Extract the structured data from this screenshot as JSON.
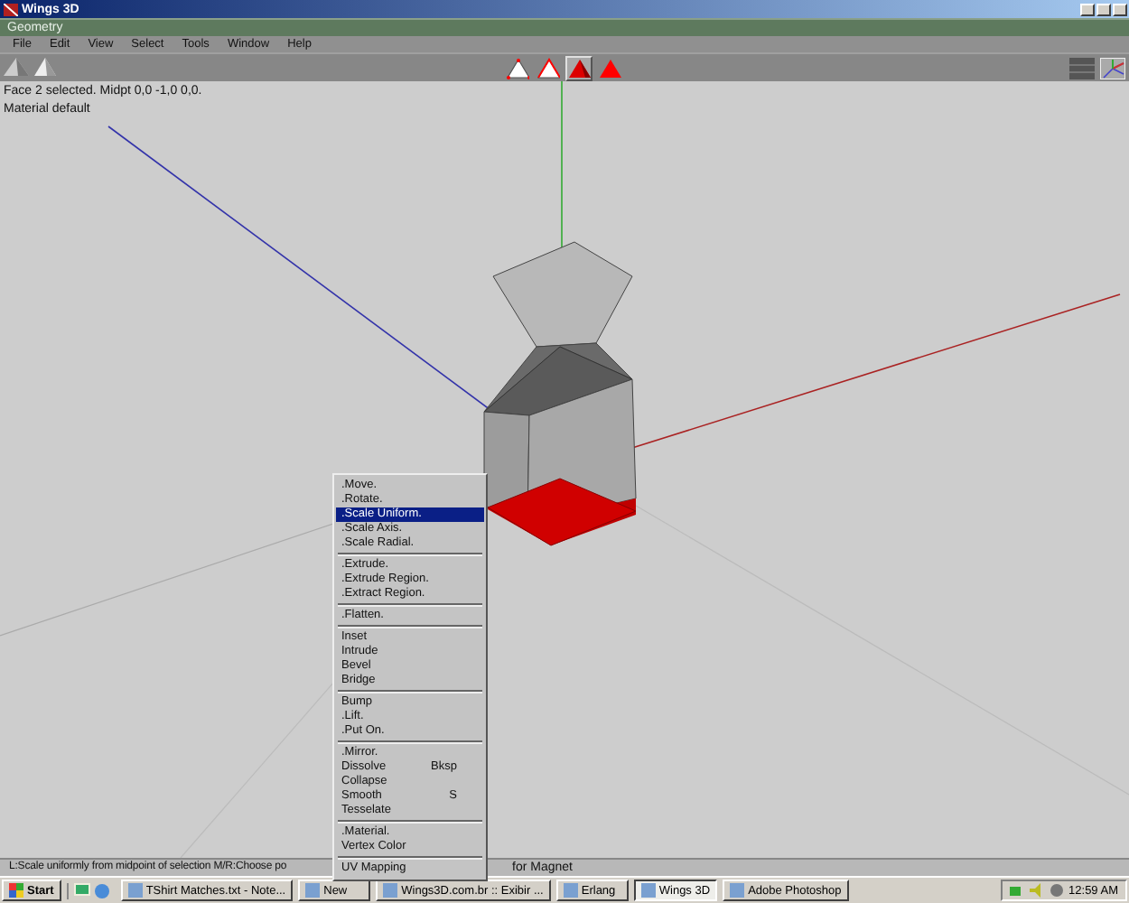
{
  "window": {
    "title": "Wings 3D"
  },
  "panel_title": "Geometry",
  "menu_bar": [
    "File",
    "Edit",
    "View",
    "Select",
    "Tools",
    "Window",
    "Help"
  ],
  "selection_modes": [
    {
      "kind": "vertex",
      "selected": false
    },
    {
      "kind": "edge",
      "selected": false
    },
    {
      "kind": "face",
      "selected": true
    },
    {
      "kind": "body",
      "selected": false
    }
  ],
  "info_lines": [
    "Face 2 selected. Midpt 0,0 -1,0 0,0.",
    "Material default"
  ],
  "context_menu": [
    {
      "kind": "item",
      "label": ".Move.",
      "selected": false
    },
    {
      "kind": "item",
      "label": ".Rotate.",
      "selected": false
    },
    {
      "kind": "item",
      "label": ".Scale Uniform.",
      "selected": true
    },
    {
      "kind": "item",
      "label": ".Scale Axis.",
      "selected": false
    },
    {
      "kind": "item",
      "label": ".Scale Radial.",
      "selected": false
    },
    {
      "kind": "separator"
    },
    {
      "kind": "item",
      "label": ".Extrude.",
      "selected": false
    },
    {
      "kind": "item",
      "label": ".Extrude Region.",
      "selected": false
    },
    {
      "kind": "item",
      "label": ".Extract Region.",
      "selected": false
    },
    {
      "kind": "separator"
    },
    {
      "kind": "item",
      "label": ".Flatten.",
      "selected": false
    },
    {
      "kind": "separator"
    },
    {
      "kind": "item",
      "label": "Inset",
      "selected": false
    },
    {
      "kind": "item",
      "label": "Intrude",
      "selected": false
    },
    {
      "kind": "item",
      "label": "Bevel",
      "selected": false
    },
    {
      "kind": "item",
      "label": "Bridge",
      "selected": false
    },
    {
      "kind": "separator"
    },
    {
      "kind": "item",
      "label": "Bump",
      "selected": false
    },
    {
      "kind": "item",
      "label": ".Lift.",
      "selected": false
    },
    {
      "kind": "item",
      "label": ".Put On.",
      "selected": false
    },
    {
      "kind": "separator"
    },
    {
      "kind": "item",
      "label": ".Mirror.",
      "selected": false
    },
    {
      "kind": "item",
      "label": "Dissolve",
      "shortcut": "Bksp",
      "selected": false
    },
    {
      "kind": "item",
      "label": "Collapse",
      "selected": false
    },
    {
      "kind": "item",
      "label": "Smooth",
      "shortcut": "S",
      "selected": false
    },
    {
      "kind": "item",
      "label": "Tesselate",
      "selected": false
    },
    {
      "kind": "separator"
    },
    {
      "kind": "item",
      "label": ".Material.",
      "selected": false
    },
    {
      "kind": "item",
      "label": "Vertex Color",
      "selected": false
    },
    {
      "kind": "separator"
    },
    {
      "kind": "item",
      "label": "UV Mapping",
      "selected": false
    }
  ],
  "status_bar": [
    "L:Scale uniformly from midpoint of selection  M/R:Choose po",
    "for Magnet"
  ],
  "taskbar": {
    "start": "Start",
    "tasks": [
      {
        "label": "TShirt Matches.txt - Note...",
        "selected": false
      },
      {
        "label": "New",
        "selected": false
      },
      {
        "label": "Wings3D.com.br :: Exibir ...",
        "selected": false
      },
      {
        "label": "Erlang",
        "selected": false
      },
      {
        "label": "Wings 3D",
        "selected": true
      },
      {
        "label": "Adobe Photoshop",
        "selected": false
      }
    ],
    "clock": "12:59 AM"
  }
}
